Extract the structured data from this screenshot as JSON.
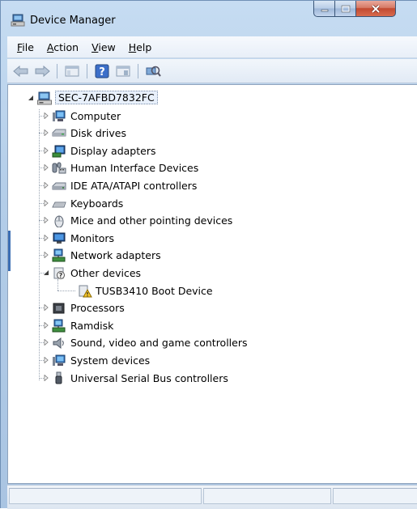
{
  "window": {
    "title": "Device Manager"
  },
  "menu": [
    {
      "label_pre": "",
      "label_u": "F",
      "label_post": "ile"
    },
    {
      "label_pre": "",
      "label_u": "A",
      "label_post": "ction"
    },
    {
      "label_pre": "",
      "label_u": "V",
      "label_post": "iew"
    },
    {
      "label_pre": "",
      "label_u": "H",
      "label_post": "elp"
    }
  ],
  "tree": {
    "root": "SEC-7AFBD7832FC",
    "categories": [
      {
        "label": "Computer",
        "icon": "computer-icon",
        "expanded": false
      },
      {
        "label": "Disk drives",
        "icon": "disk-drive-icon",
        "expanded": false
      },
      {
        "label": "Display adapters",
        "icon": "display-adapter-icon",
        "expanded": false
      },
      {
        "label": "Human Interface Devices",
        "icon": "hid-icon",
        "expanded": false
      },
      {
        "label": "IDE ATA/ATAPI controllers",
        "icon": "ide-controller-icon",
        "expanded": false
      },
      {
        "label": "Keyboards",
        "icon": "keyboard-icon",
        "expanded": false
      },
      {
        "label": "Mice and other pointing devices",
        "icon": "mouse-icon",
        "expanded": false
      },
      {
        "label": "Monitors",
        "icon": "monitor-icon",
        "expanded": false
      },
      {
        "label": "Network adapters",
        "icon": "network-adapter-icon",
        "expanded": false
      },
      {
        "label": "Other devices",
        "icon": "unknown-device-icon",
        "expanded": true,
        "children": [
          {
            "label": "TUSB3410 Boot Device",
            "icon": "warning-device-icon"
          }
        ]
      },
      {
        "label": "Processors",
        "icon": "processor-icon",
        "expanded": false
      },
      {
        "label": "Ramdisk",
        "icon": "ramdisk-icon",
        "expanded": false
      },
      {
        "label": "Sound, video and game controllers",
        "icon": "sound-icon",
        "expanded": false
      },
      {
        "label": "System devices",
        "icon": "system-devices-icon",
        "expanded": false
      },
      {
        "label": "Universal Serial Bus controllers",
        "icon": "usb-icon",
        "expanded": false
      }
    ]
  }
}
